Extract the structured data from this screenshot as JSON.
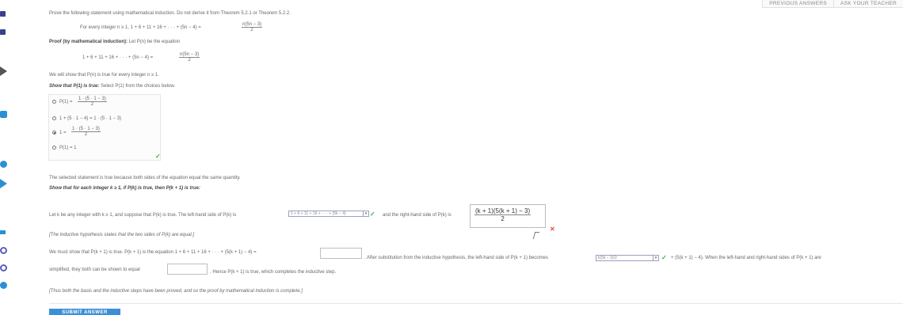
{
  "header": {
    "previous_answers": "PREVIOUS ANSWERS",
    "ask_teacher": "ASK YOUR TEACHER"
  },
  "problem": {
    "instruction": "Prove the following statement using mathematical induction. Do not derive it from Theorem 5.2.1 or Theorem 5.2.2.",
    "statement_prefix": "For every integer n ≥ 1, 1 + 6 + 11 + 16 + · · · + (5n − 4) =",
    "statement_num": "n(5n − 3)",
    "statement_den": "2"
  },
  "proof": {
    "heading_bold": "Proof (by mathematical induction):",
    "heading_rest": " Let P(n) be the equation",
    "equation_prefix": "1 + 6 + 11 + 16 + · · · + (5n − 4) =",
    "equation_num": "n(5n − 3)",
    "equation_den": "2",
    "we_will_show": "We will show that P(n) is true for every integer n ≥ 1.",
    "show_p1_bold": "Show that P(1) is true:",
    "show_p1_rest": " Select P(1) from the choices below."
  },
  "choices": [
    {
      "label_prefix": "P(1) =",
      "num": "1 · (5 · 1 − 3)",
      "den": "2",
      "selected": false
    },
    {
      "label_prefix": "1 + (5 · 1 − 4) = 1 · (5 · 1 − 3)",
      "num": "",
      "den": "",
      "selected": false
    },
    {
      "label_prefix": "1 =",
      "num": "1 · (5 · 1 − 3)",
      "den": "2",
      "selected": true
    },
    {
      "label_prefix": "P(1) = 1",
      "num": "",
      "den": "",
      "selected": false
    }
  ],
  "check_mark": "✓",
  "x_mark": "✕",
  "selected_true": "The selected statement is true because both sides of the equation equal the same quantity.",
  "inductive_heading": "Show that for each integer k ≥ 1, if P(k) is true, then P(k + 1) is true:",
  "inductive": {
    "line1_a": "Let k be any integer with k ≥ 1, and suppose that P(k) is true. The left-hand side of P(k) is",
    "select_lhs": "1 + 6 + 11 + 16 + · · · + (5k − 4)",
    "line1_b": "and the right-hand side of P(k) is",
    "rhs_num": "(k + 1)(5(k + 1) − 3)",
    "rhs_den": "2",
    "hypothesis_note": "[The inductive hypothesis states that the two sides of P(k) are equal.]",
    "line2_a": "We must show that P(k + 1) is true. P(k + 1) is the equation 1 + 6 + 11 + 16 + · · · + (5(k + 1) − 4) =",
    "line2_b": ". After substitution from the inductive hypothesis, the left-hand side of P(k + 1) becomes",
    "select_sub": "k(5k − 3)/2",
    "line2_c": "+ (5(k + 1) − 4). When the left-hand and right-hand sides of P(k + 1) are",
    "line3_a": "simplified, they both can be shown to equal",
    "line3_b": ". Hence P(k + 1) is true, which completes the inductive step.",
    "conclusion": "[Thus both the basis and the inductive steps have been proved, and so the proof by mathematical induction is complete.]"
  },
  "submit_label": "SUBMIT ANSWER"
}
